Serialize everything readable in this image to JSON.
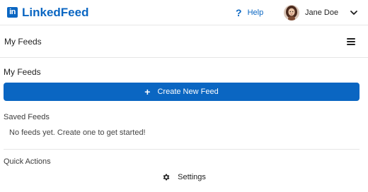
{
  "app": {
    "name": "LinkedFeed",
    "logo_text": "in",
    "brand_color": "#0a66c2"
  },
  "header": {
    "help_icon": "?",
    "help_label": "Help",
    "user_name": "Jane Doe",
    "avatar_icon": "avatar",
    "dropdown_icon": "chevron-down-icon"
  },
  "subheader": {
    "title": "My Feeds",
    "menu_icon": "hamburger-menu-icon"
  },
  "main": {
    "section_title": "My Feeds",
    "create_button": {
      "icon": "+",
      "label": "Create New Feed"
    },
    "saved_feeds_label": "Saved Feeds",
    "empty_message": "No feeds yet. Create one to get started!",
    "quick_actions_label": "Quick Actions",
    "settings": {
      "icon": "gear-icon",
      "label": "Settings"
    }
  }
}
